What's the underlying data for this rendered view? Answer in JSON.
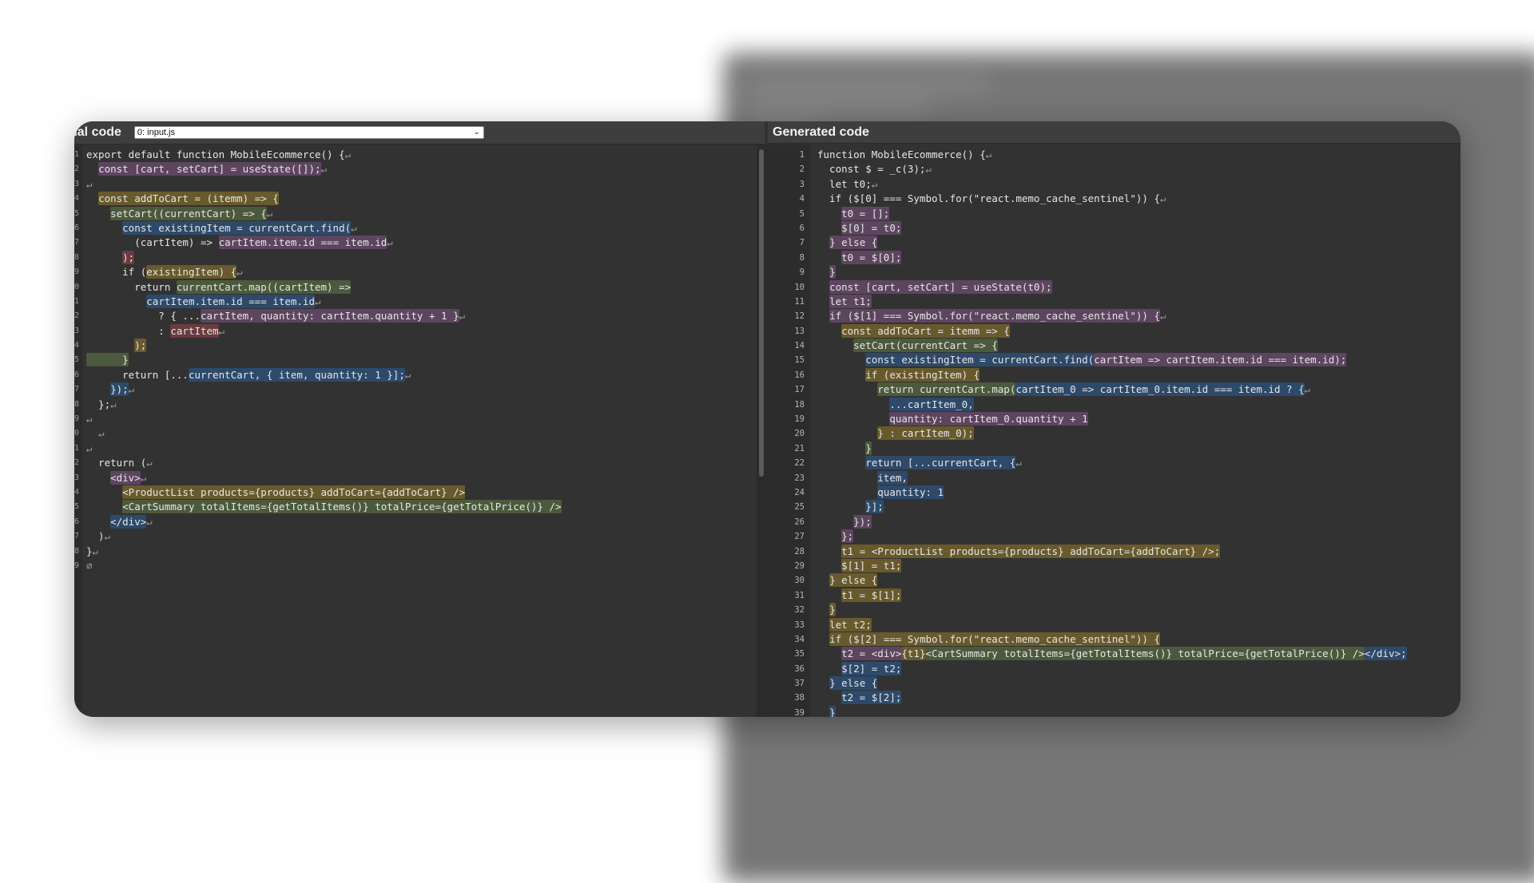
{
  "header": {
    "left_title": "nal code",
    "file_select_value": "0: input.js",
    "right_title": "Generated code"
  },
  "colors": {
    "window_bg": "#323232",
    "highlight_purple": "#5d4560",
    "highlight_olive": "#685a2c",
    "highlight_green": "#4b5a3c",
    "highlight_blue": "#2e4a6a",
    "highlight_red": "#6a3b3f"
  },
  "original_code": [
    {
      "n": "1",
      "segs": [
        {
          "t": "export default function MobileEcommerce() {"
        },
        {
          "t": "↵",
          "c": "rl"
        }
      ]
    },
    {
      "n": "2",
      "segs": [
        {
          "t": "  "
        },
        {
          "t": "const [cart, setCart] = useState([]);",
          "c": "h-purple"
        },
        {
          "t": "↵",
          "c": "rl"
        }
      ]
    },
    {
      "n": "3",
      "segs": [
        {
          "t": "↵",
          "c": "rl"
        }
      ]
    },
    {
      "n": "4",
      "segs": [
        {
          "t": "  "
        },
        {
          "t": "const addToCart = (itemm) => {",
          "c": "h-olive"
        }
      ]
    },
    {
      "n": "5",
      "segs": [
        {
          "t": "    "
        },
        {
          "t": "setCart((currentCart) => {",
          "c": "h-green"
        },
        {
          "t": "↵",
          "c": "rl"
        }
      ]
    },
    {
      "n": "6",
      "segs": [
        {
          "t": "      "
        },
        {
          "t": "const existingItem = currentCart.find(",
          "c": "h-blue"
        },
        {
          "t": "↵",
          "c": "rl"
        }
      ]
    },
    {
      "n": "7",
      "segs": [
        {
          "t": "        (cartItem) => "
        },
        {
          "t": "cartItem.item.id === item.id",
          "c": "h-purple"
        },
        {
          "t": "↵",
          "c": "rl"
        }
      ]
    },
    {
      "n": "8",
      "segs": [
        {
          "t": "      "
        },
        {
          "t": ");",
          "c": "h-red"
        }
      ]
    },
    {
      "n": "9",
      "segs": [
        {
          "t": "      if ("
        },
        {
          "t": "existingItem) {",
          "c": "h-olive"
        },
        {
          "t": "↵",
          "c": "rl"
        }
      ]
    },
    {
      "n": "0",
      "segs": [
        {
          "t": "        return "
        },
        {
          "t": "currentCart.map((cartItem) =>",
          "c": "h-green"
        }
      ]
    },
    {
      "n": "1",
      "segs": [
        {
          "t": "          "
        },
        {
          "t": "cartItem.item.id === item.id",
          "c": "h-blue"
        },
        {
          "t": "↵",
          "c": "rl"
        }
      ]
    },
    {
      "n": "2",
      "segs": [
        {
          "t": "            ? { ..."
        },
        {
          "t": "cartItem, quantity: cartItem.quantity + 1 }",
          "c": "h-purple"
        },
        {
          "t": "↵",
          "c": "rl"
        }
      ]
    },
    {
      "n": "3",
      "segs": [
        {
          "t": "            : "
        },
        {
          "t": "cartItem",
          "c": "h-red"
        },
        {
          "t": "↵",
          "c": "rl"
        }
      ]
    },
    {
      "n": "4",
      "segs": [
        {
          "t": "        "
        },
        {
          "t": ");",
          "c": "h-olive"
        }
      ]
    },
    {
      "n": "5",
      "segs": [
        {
          "t": "      }",
          "c": "h-green"
        }
      ]
    },
    {
      "n": "6",
      "segs": [
        {
          "t": "      return [..."
        },
        {
          "t": "currentCart, { item, quantity: 1 }];",
          "c": "h-blue"
        },
        {
          "t": "↵",
          "c": "rl"
        }
      ]
    },
    {
      "n": "7",
      "segs": [
        {
          "t": "    "
        },
        {
          "t": "});",
          "c": "h-blue"
        },
        {
          "t": "↵",
          "c": "rl"
        }
      ]
    },
    {
      "n": "8",
      "segs": [
        {
          "t": "  };"
        },
        {
          "t": "↵",
          "c": "rl"
        }
      ]
    },
    {
      "n": "9",
      "segs": [
        {
          "t": "↵",
          "c": "rl"
        }
      ]
    },
    {
      "n": "0",
      "segs": [
        {
          "t": "  "
        },
        {
          "t": "↵",
          "c": "rl"
        }
      ]
    },
    {
      "n": "1",
      "segs": [
        {
          "t": "↵",
          "c": "rl"
        }
      ]
    },
    {
      "n": "2",
      "segs": [
        {
          "t": "  return ("
        },
        {
          "t": "↵",
          "c": "rl"
        }
      ]
    },
    {
      "n": "3",
      "segs": [
        {
          "t": "    "
        },
        {
          "t": "<div>",
          "c": "h-purple"
        },
        {
          "t": "↵",
          "c": "rl"
        }
      ]
    },
    {
      "n": "4",
      "segs": [
        {
          "t": "      "
        },
        {
          "t": "<ProductList products={products} addToCart={addToCart} />",
          "c": "h-olive"
        }
      ]
    },
    {
      "n": "5",
      "segs": [
        {
          "t": "      "
        },
        {
          "t": "<CartSummary totalItems={getTotalItems()} totalPrice={getTotalPrice()} />",
          "c": "h-green"
        }
      ]
    },
    {
      "n": "6",
      "segs": [
        {
          "t": "    "
        },
        {
          "t": "</div>",
          "c": "h-blue"
        },
        {
          "t": "↵",
          "c": "rl"
        }
      ]
    },
    {
      "n": "7",
      "segs": [
        {
          "t": "  )"
        },
        {
          "t": "↵",
          "c": "rl"
        }
      ]
    },
    {
      "n": "8",
      "segs": [
        {
          "t": "}"
        },
        {
          "t": "↵",
          "c": "rl"
        }
      ]
    },
    {
      "n": "9",
      "segs": [
        {
          "t": "∅",
          "c": "rl"
        }
      ]
    }
  ],
  "generated_code": [
    {
      "n": "1",
      "segs": [
        {
          "t": "function MobileEcommerce() {"
        },
        {
          "t": "↵",
          "c": "rl"
        }
      ]
    },
    {
      "n": "2",
      "segs": [
        {
          "t": "  const $ = _c(3);"
        },
        {
          "t": "↵",
          "c": "rl"
        }
      ]
    },
    {
      "n": "3",
      "segs": [
        {
          "t": "  let t0;"
        },
        {
          "t": "↵",
          "c": "rl"
        }
      ]
    },
    {
      "n": "4",
      "segs": [
        {
          "t": "  if ($[0] === Symbol.for(\"react.memo_cache_sentinel\")) {"
        },
        {
          "t": "↵",
          "c": "rl"
        }
      ]
    },
    {
      "n": "5",
      "segs": [
        {
          "t": "    "
        },
        {
          "t": "t0 = [];",
          "c": "h-purple"
        }
      ]
    },
    {
      "n": "6",
      "segs": [
        {
          "t": "    "
        },
        {
          "t": "$[0] = t0;",
          "c": "h-purple"
        }
      ]
    },
    {
      "n": "7",
      "segs": [
        {
          "t": "  "
        },
        {
          "t": "} else {",
          "c": "h-purple"
        }
      ]
    },
    {
      "n": "8",
      "segs": [
        {
          "t": "    "
        },
        {
          "t": "t0 = $[0];",
          "c": "h-purple"
        }
      ]
    },
    {
      "n": "9",
      "segs": [
        {
          "t": "  "
        },
        {
          "t": "}",
          "c": "h-purple"
        }
      ]
    },
    {
      "n": "10",
      "segs": [
        {
          "t": "  "
        },
        {
          "t": "const [cart, setCart] = useState(t0);",
          "c": "h-purple"
        }
      ]
    },
    {
      "n": "11",
      "segs": [
        {
          "t": "  "
        },
        {
          "t": "let t1;",
          "c": "h-purple"
        }
      ]
    },
    {
      "n": "12",
      "segs": [
        {
          "t": "  "
        },
        {
          "t": "if ($[1] === Symbol.for(\"react.memo_cache_sentinel\")) {",
          "c": "h-purple"
        },
        {
          "t": "↵",
          "c": "rl"
        }
      ]
    },
    {
      "n": "13",
      "segs": [
        {
          "t": "    "
        },
        {
          "t": "const addToCart = itemm => {",
          "c": "h-olive"
        }
      ]
    },
    {
      "n": "14",
      "segs": [
        {
          "t": "      "
        },
        {
          "t": "setCart(currentCart => {",
          "c": "h-green"
        }
      ]
    },
    {
      "n": "15",
      "segs": [
        {
          "t": "        "
        },
        {
          "t": "const existingItem = currentCart.find(",
          "c": "h-blue"
        },
        {
          "t": "cartItem => cartItem.item.id === item.id);",
          "c": "h-purple"
        }
      ]
    },
    {
      "n": "16",
      "segs": [
        {
          "t": "        "
        },
        {
          "t": "if (existingItem) {",
          "c": "h-olive"
        }
      ]
    },
    {
      "n": "17",
      "segs": [
        {
          "t": "          "
        },
        {
          "t": "return currentCart.map(",
          "c": "h-green"
        },
        {
          "t": "cartItem_0 => cartItem_0.item.id === item.id ? {",
          "c": "h-blue"
        },
        {
          "t": "↵",
          "c": "rl"
        }
      ]
    },
    {
      "n": "18",
      "segs": [
        {
          "t": "            "
        },
        {
          "t": "...cartItem_0,",
          "c": "h-blue"
        }
      ]
    },
    {
      "n": "19",
      "segs": [
        {
          "t": "            "
        },
        {
          "t": "quantity: cartItem_0.quantity + 1",
          "c": "h-purple"
        }
      ]
    },
    {
      "n": "20",
      "segs": [
        {
          "t": "          "
        },
        {
          "t": "} : cartItem_0);",
          "c": "h-olive"
        }
      ]
    },
    {
      "n": "21",
      "segs": [
        {
          "t": "        "
        },
        {
          "t": "}",
          "c": "h-green"
        }
      ]
    },
    {
      "n": "22",
      "segs": [
        {
          "t": "        "
        },
        {
          "t": "return [...currentCart, {",
          "c": "h-blue"
        },
        {
          "t": "↵",
          "c": "rl"
        }
      ]
    },
    {
      "n": "23",
      "segs": [
        {
          "t": "          "
        },
        {
          "t": "item,",
          "c": "h-blue"
        }
      ]
    },
    {
      "n": "24",
      "segs": [
        {
          "t": "          "
        },
        {
          "t": "quantity: 1",
          "c": "h-blue"
        }
      ]
    },
    {
      "n": "25",
      "segs": [
        {
          "t": "        "
        },
        {
          "t": "}];",
          "c": "h-blue"
        }
      ]
    },
    {
      "n": "26",
      "segs": [
        {
          "t": "      "
        },
        {
          "t": "});",
          "c": "h-purple"
        }
      ]
    },
    {
      "n": "27",
      "segs": [
        {
          "t": "    "
        },
        {
          "t": "};",
          "c": "h-purple"
        }
      ]
    },
    {
      "n": "28",
      "segs": [
        {
          "t": "    "
        },
        {
          "t": "t1 = <ProductList products={products} addToCart={addToCart} />;",
          "c": "h-olive"
        }
      ]
    },
    {
      "n": "29",
      "segs": [
        {
          "t": "    "
        },
        {
          "t": "$[1] = t1;",
          "c": "h-olive"
        }
      ]
    },
    {
      "n": "30",
      "segs": [
        {
          "t": "  "
        },
        {
          "t": "} else {",
          "c": "h-olive"
        }
      ]
    },
    {
      "n": "31",
      "segs": [
        {
          "t": "    "
        },
        {
          "t": "t1 = $[1];",
          "c": "h-olive"
        }
      ]
    },
    {
      "n": "32",
      "segs": [
        {
          "t": "  "
        },
        {
          "t": "}",
          "c": "h-olive"
        }
      ]
    },
    {
      "n": "33",
      "segs": [
        {
          "t": "  "
        },
        {
          "t": "let t2;",
          "c": "h-olive"
        }
      ]
    },
    {
      "n": "34",
      "segs": [
        {
          "t": "  "
        },
        {
          "t": "if ($[2] === Symbol.for(\"react.memo_cache_sentinel\")) {",
          "c": "h-olive"
        }
      ]
    },
    {
      "n": "35",
      "segs": [
        {
          "t": "    "
        },
        {
          "t": "t2 = <div>",
          "c": "h-purple"
        },
        {
          "t": "{t1}",
          "c": "h-olive"
        },
        {
          "t": "<CartSummary totalItems={getTotalItems()} totalPrice={getTotalPrice()} />",
          "c": "h-green"
        },
        {
          "t": "</div>;",
          "c": "h-blue"
        }
      ]
    },
    {
      "n": "36",
      "segs": [
        {
          "t": "    "
        },
        {
          "t": "$[2] = t2;",
          "c": "h-blue"
        }
      ]
    },
    {
      "n": "37",
      "segs": [
        {
          "t": "  "
        },
        {
          "t": "} else {",
          "c": "h-blue"
        }
      ]
    },
    {
      "n": "38",
      "segs": [
        {
          "t": "    "
        },
        {
          "t": "t2 = $[2];",
          "c": "h-blue"
        }
      ]
    },
    {
      "n": "39",
      "segs": [
        {
          "t": "  "
        },
        {
          "t": "}",
          "c": "h-blue"
        }
      ]
    }
  ]
}
